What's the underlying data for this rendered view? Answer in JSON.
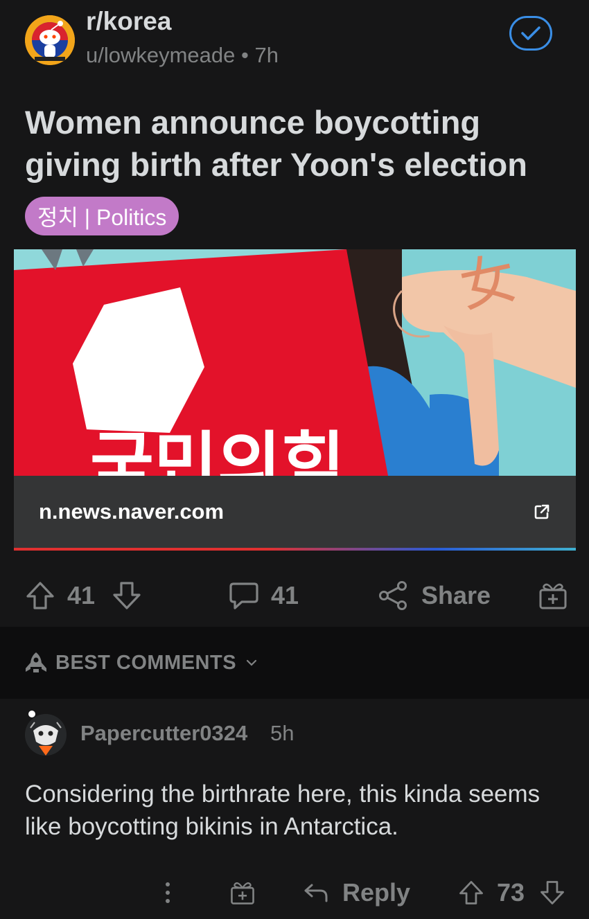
{
  "post": {
    "subreddit": "r/korea",
    "author": "u/lowkeymeade",
    "separator": "•",
    "age": "7h",
    "title": "Women announce boycotting giving birth after Yoon's election",
    "flair": "정치 | Politics",
    "link_domain": "n.news.naver.com",
    "thumbnail_text": "국민의힘",
    "thumbnail_glyph": "女"
  },
  "actions": {
    "upvotes": "41",
    "comments": "41",
    "share_label": "Share"
  },
  "sort": {
    "label": "BEST COMMENTS"
  },
  "comment": {
    "author": "Papercutter0324",
    "age": "5h",
    "body": "Considering the birthrate here, this kinda seems like boycotting bikinis in Antarctica.",
    "reply_label": "Reply",
    "score": "73"
  },
  "colors": {
    "background": "#161617",
    "text": "#d7dadc",
    "muted": "#818384",
    "flair": "#c27ac8",
    "accent_blue": "#3a8ee6"
  },
  "icons": [
    "subreddit-avatar-icon",
    "check-icon",
    "upvote-icon",
    "downvote-icon",
    "comment-icon",
    "share-icon",
    "award-icon",
    "rocket-icon",
    "chevron-down-icon",
    "more-icon",
    "reply-icon",
    "external-link-icon"
  ]
}
